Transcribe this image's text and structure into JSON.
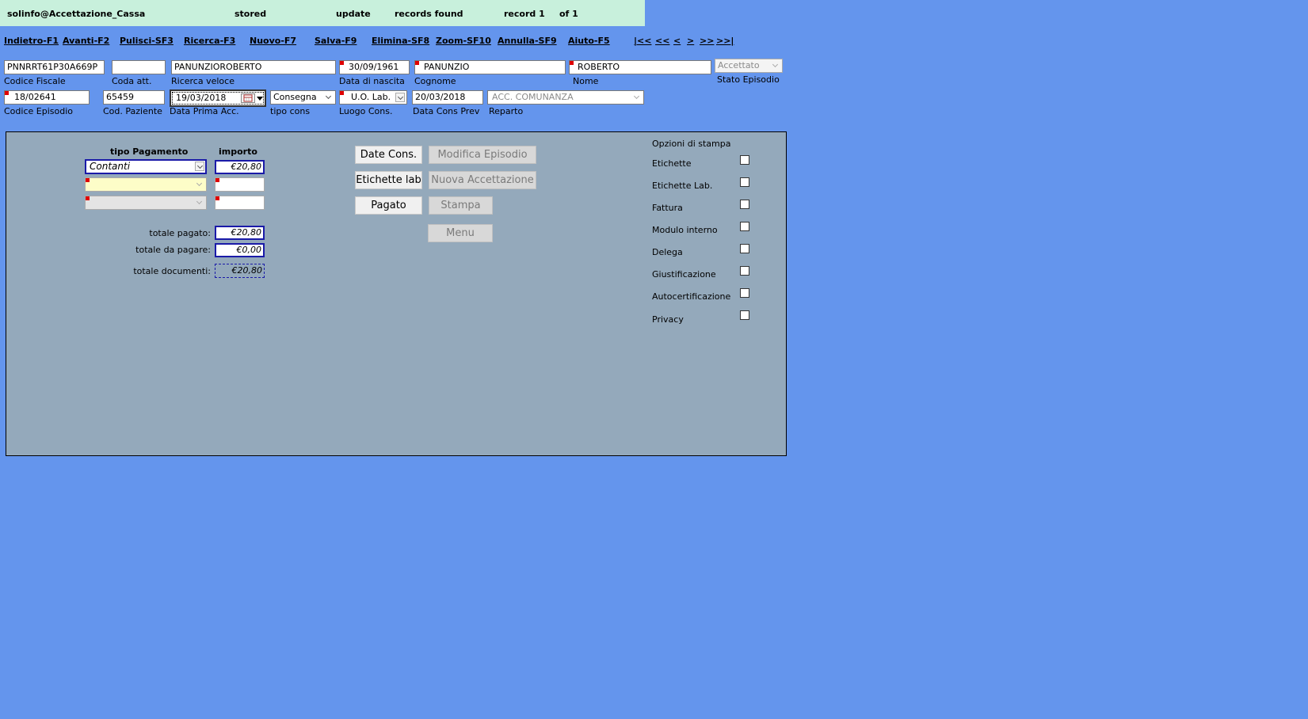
{
  "status": {
    "user": "solinfo@Accettazione_Cassa",
    "stored": "stored",
    "update": "update",
    "records_found": "records found",
    "record": "record 1",
    "of": "of 1"
  },
  "menu": {
    "back": "Indietro-F1",
    "forward": "Avanti-F2",
    "clear": "Pulisci-SF3",
    "search": "Ricerca-F3",
    "new": "Nuovo-F7",
    "save": "Salva-F9",
    "delete": "Elimina-SF8",
    "zoom": "Zoom-SF10",
    "cancel": "Annulla-SF9",
    "help": "Aiuto-F5",
    "nav_first": "|<<",
    "nav_prev_page": "<<",
    "nav_prev": "<",
    "nav_next": ">",
    "nav_next_page": ">>",
    "nav_last": ">>|"
  },
  "fields": {
    "codice_fiscale": {
      "label": "Codice Fiscale",
      "value": "PNNRRT61P30A669P"
    },
    "coda_att": {
      "label": "Coda att.",
      "value": ""
    },
    "ricerca_veloce": {
      "label": "Ricerca veloce",
      "value": "PANUNZIOROBERTO"
    },
    "data_nascita": {
      "label": "Data di nascita",
      "value": "30/09/1961"
    },
    "cognome": {
      "label": "Cognome",
      "value": "PANUNZIO"
    },
    "nome": {
      "label": "Nome",
      "value": "ROBERTO"
    },
    "stato_episodio": {
      "label": "Stato Episodio",
      "value": "Accettato"
    },
    "codice_episodio": {
      "label": "Codice Episodio",
      "value": "18/02641"
    },
    "cod_paziente": {
      "label": "Cod. Paziente",
      "value": "65459"
    },
    "data_prima_acc": {
      "label": "Data Prima Acc.",
      "value": "19/03/2018"
    },
    "tipo_cons": {
      "label": "tipo cons",
      "value": "Consegna"
    },
    "luogo_cons": {
      "label": "Luogo Cons.",
      "value": "U.O. Lab."
    },
    "data_cons_prev": {
      "label": "Data Cons Prev",
      "value": "20/03/2018"
    },
    "reparto": {
      "label": "Reparto",
      "value": "ACC. COMUNANZA"
    }
  },
  "payment": {
    "col_tipo": "tipo Pagamento",
    "col_importo": "importo",
    "rows": [
      {
        "tipo": "Contanti",
        "importo": "€20,80"
      },
      {
        "tipo": "",
        "importo": ""
      },
      {
        "tipo": "",
        "importo": ""
      }
    ],
    "totale_pagato_label": "totale pagato:",
    "totale_pagato": "€20,80",
    "totale_da_pagare_label": "totale da pagare:",
    "totale_da_pagare": "€0,00",
    "totale_documenti_label": "totale documenti:",
    "totale_documenti": "€20,80"
  },
  "buttons": {
    "date_cons": "Date Cons.",
    "modifica_episodio": "Modifica Episodio",
    "etichette_lab": "Etichette lab",
    "nuova_accettazione": "Nuova Accettazione",
    "pagato": "Pagato",
    "stampa": "Stampa",
    "menu": "Menu"
  },
  "print_options": {
    "title": "Opzioni di stampa",
    "items": [
      {
        "label": "Etichette",
        "checked": false
      },
      {
        "label": "Etichette Lab.",
        "checked": false
      },
      {
        "label": "Fattura",
        "checked": false
      },
      {
        "label": "Modulo interno",
        "checked": false
      },
      {
        "label": "Delega",
        "checked": false
      },
      {
        "label": "Giustificazione",
        "checked": false
      },
      {
        "label": "Autocertificazione",
        "checked": false
      },
      {
        "label": "Privacy",
        "checked": false
      }
    ]
  },
  "colors": {
    "background": "#6495ed",
    "status_bar": "#c8f0dc",
    "panel": "#94a9bb",
    "required_flag": "#e00000",
    "focus_border": "#1a1aa8"
  }
}
